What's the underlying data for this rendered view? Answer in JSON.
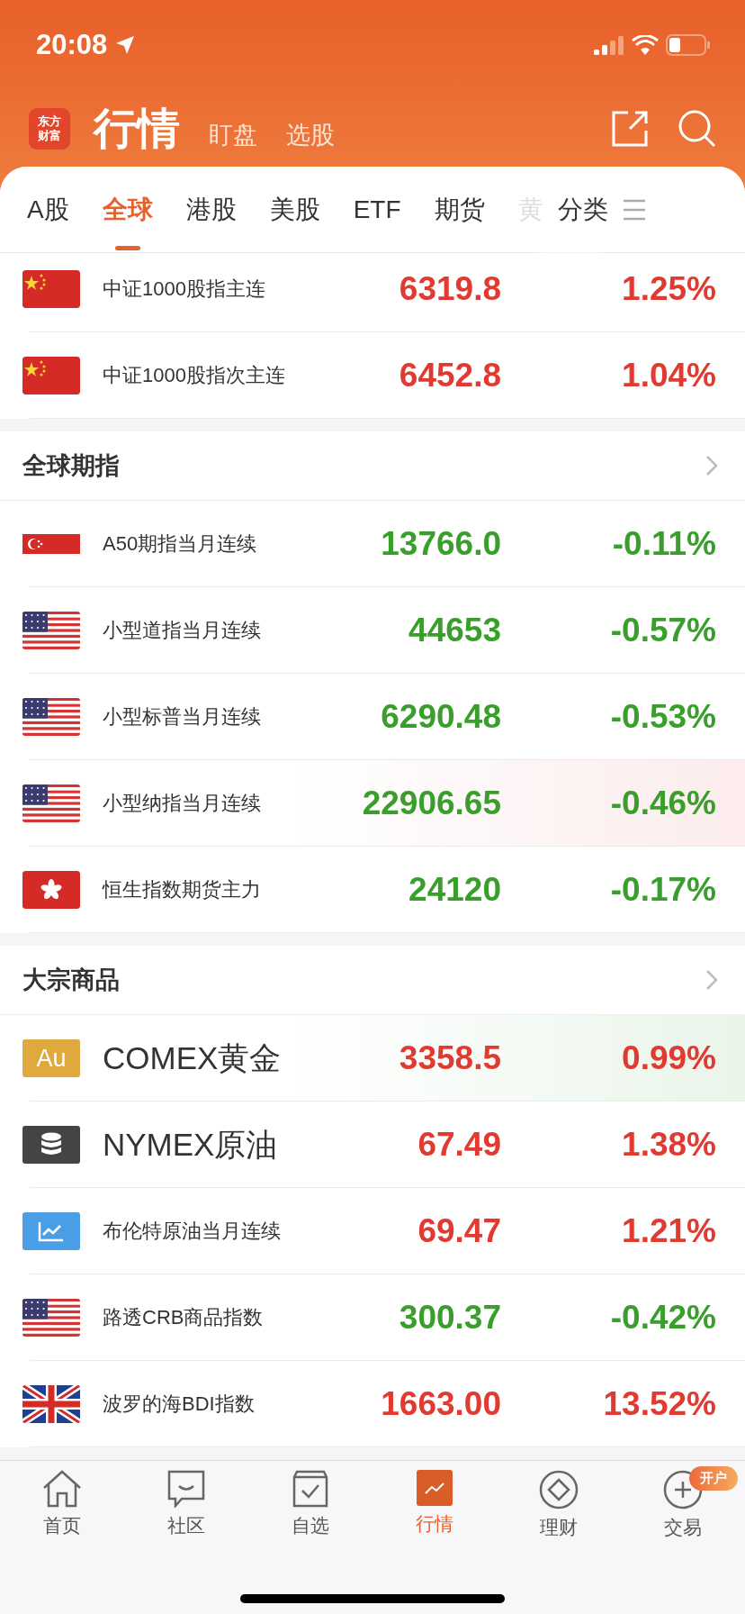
{
  "status_bar": {
    "time": "20:08"
  },
  "header": {
    "logo": "东方财富",
    "title": "行情",
    "links": [
      "盯盘",
      "选股"
    ]
  },
  "tabs": [
    {
      "label": "A股",
      "selected": false,
      "faded": false
    },
    {
      "label": "全球",
      "selected": true,
      "faded": false
    },
    {
      "label": "港股",
      "selected": false,
      "faded": false
    },
    {
      "label": "美股",
      "selected": false,
      "faded": false
    },
    {
      "label": "ETF",
      "selected": false,
      "faded": false
    },
    {
      "label": "期货",
      "selected": false,
      "faded": false
    },
    {
      "label": "黄",
      "selected": false,
      "faded": true
    }
  ],
  "category_button": "分类",
  "sections": [
    {
      "rows": [
        {
          "kind": "cn-flag",
          "name": "中证1000股指主连",
          "price": "6319.8",
          "change": "1.25%",
          "color": "#e03a31",
          "emphasis": false
        },
        {
          "kind": "cn-flag",
          "name": "中证1000股指次主连",
          "price": "6452.8",
          "change": "1.04%",
          "color": "#e03a31",
          "emphasis": false
        }
      ]
    },
    {
      "title": "全球期指",
      "rows": [
        {
          "kind": "sg-flag",
          "name": "A50期指当月连续",
          "price": "13766.0",
          "change": "-0.11%",
          "color": "#3a9e2c",
          "emphasis": false
        },
        {
          "kind": "us-flag",
          "name": "小型道指当月连续",
          "price": "44653",
          "change": "-0.57%",
          "color": "#3a9e2c",
          "emphasis": false
        },
        {
          "kind": "us-flag",
          "name": "小型标普当月连续",
          "price": "6290.48",
          "change": "-0.53%",
          "color": "#3a9e2c",
          "emphasis": false
        },
        {
          "kind": "us-flag",
          "name": "小型纳指当月连续",
          "price": "22906.65",
          "change": "-0.46%",
          "color": "#3a9e2c",
          "emphasis": false,
          "flash": {
            "color": "#fcecec"
          }
        },
        {
          "kind": "hk-flag",
          "name": "恒生指数期货主力",
          "price": "24120",
          "change": "-0.17%",
          "color": "#3a9e2c",
          "emphasis": false
        }
      ]
    },
    {
      "title": "大宗商品",
      "rows": [
        {
          "kind": "gold",
          "icon_text": "Au",
          "name": "COMEX黄金",
          "price": "3358.5",
          "change": "0.99%",
          "color": "#e03a31",
          "emphasis": true,
          "flash": {
            "color": "#eaf5ea"
          }
        },
        {
          "kind": "oil",
          "name": "NYMEX原油",
          "price": "67.49",
          "change": "1.38%",
          "color": "#e03a31",
          "emphasis": true
        },
        {
          "kind": "chart",
          "name": "布伦特原油当月连续",
          "price": "69.47",
          "change": "1.21%",
          "color": "#e03a31",
          "emphasis": false
        },
        {
          "kind": "us-flag",
          "name": "路透CRB商品指数",
          "price": "300.37",
          "change": "-0.42%",
          "color": "#3a9e2c",
          "emphasis": false
        },
        {
          "kind": "uk-flag",
          "name": "波罗的海BDI指数",
          "price": "1663.00",
          "change": "13.52%",
          "color": "#e03a31",
          "emphasis": false
        }
      ]
    }
  ],
  "bottom_nav": [
    {
      "kind": "home",
      "label": "首页",
      "selected": false
    },
    {
      "kind": "chat",
      "label": "社区",
      "selected": false
    },
    {
      "kind": "watchlist",
      "label": "自选",
      "selected": false
    },
    {
      "kind": "market",
      "label": "行情",
      "selected": true
    },
    {
      "kind": "wealth",
      "label": "理财",
      "selected": false
    },
    {
      "kind": "trade",
      "label": "交易",
      "selected": false,
      "badge": "开户"
    }
  ]
}
